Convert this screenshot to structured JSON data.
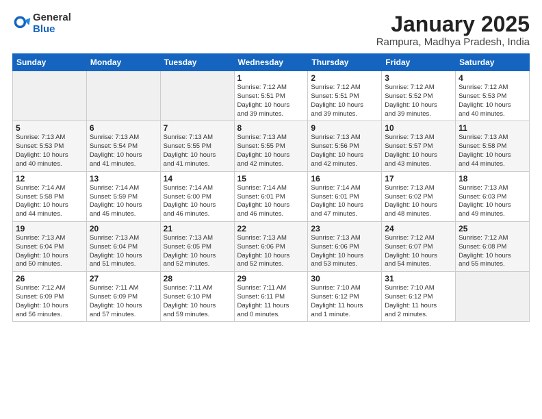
{
  "logo": {
    "general": "General",
    "blue": "Blue"
  },
  "header": {
    "title": "January 2025",
    "subtitle": "Rampura, Madhya Pradesh, India"
  },
  "weekdays": [
    "Sunday",
    "Monday",
    "Tuesday",
    "Wednesday",
    "Thursday",
    "Friday",
    "Saturday"
  ],
  "weeks": [
    [
      {
        "day": "",
        "info": ""
      },
      {
        "day": "",
        "info": ""
      },
      {
        "day": "",
        "info": ""
      },
      {
        "day": "1",
        "info": "Sunrise: 7:12 AM\nSunset: 5:51 PM\nDaylight: 10 hours\nand 39 minutes."
      },
      {
        "day": "2",
        "info": "Sunrise: 7:12 AM\nSunset: 5:51 PM\nDaylight: 10 hours\nand 39 minutes."
      },
      {
        "day": "3",
        "info": "Sunrise: 7:12 AM\nSunset: 5:52 PM\nDaylight: 10 hours\nand 39 minutes."
      },
      {
        "day": "4",
        "info": "Sunrise: 7:12 AM\nSunset: 5:53 PM\nDaylight: 10 hours\nand 40 minutes."
      }
    ],
    [
      {
        "day": "5",
        "info": "Sunrise: 7:13 AM\nSunset: 5:53 PM\nDaylight: 10 hours\nand 40 minutes."
      },
      {
        "day": "6",
        "info": "Sunrise: 7:13 AM\nSunset: 5:54 PM\nDaylight: 10 hours\nand 41 minutes."
      },
      {
        "day": "7",
        "info": "Sunrise: 7:13 AM\nSunset: 5:55 PM\nDaylight: 10 hours\nand 41 minutes."
      },
      {
        "day": "8",
        "info": "Sunrise: 7:13 AM\nSunset: 5:55 PM\nDaylight: 10 hours\nand 42 minutes."
      },
      {
        "day": "9",
        "info": "Sunrise: 7:13 AM\nSunset: 5:56 PM\nDaylight: 10 hours\nand 42 minutes."
      },
      {
        "day": "10",
        "info": "Sunrise: 7:13 AM\nSunset: 5:57 PM\nDaylight: 10 hours\nand 43 minutes."
      },
      {
        "day": "11",
        "info": "Sunrise: 7:13 AM\nSunset: 5:58 PM\nDaylight: 10 hours\nand 44 minutes."
      }
    ],
    [
      {
        "day": "12",
        "info": "Sunrise: 7:14 AM\nSunset: 5:58 PM\nDaylight: 10 hours\nand 44 minutes."
      },
      {
        "day": "13",
        "info": "Sunrise: 7:14 AM\nSunset: 5:59 PM\nDaylight: 10 hours\nand 45 minutes."
      },
      {
        "day": "14",
        "info": "Sunrise: 7:14 AM\nSunset: 6:00 PM\nDaylight: 10 hours\nand 46 minutes."
      },
      {
        "day": "15",
        "info": "Sunrise: 7:14 AM\nSunset: 6:01 PM\nDaylight: 10 hours\nand 46 minutes."
      },
      {
        "day": "16",
        "info": "Sunrise: 7:14 AM\nSunset: 6:01 PM\nDaylight: 10 hours\nand 47 minutes."
      },
      {
        "day": "17",
        "info": "Sunrise: 7:13 AM\nSunset: 6:02 PM\nDaylight: 10 hours\nand 48 minutes."
      },
      {
        "day": "18",
        "info": "Sunrise: 7:13 AM\nSunset: 6:03 PM\nDaylight: 10 hours\nand 49 minutes."
      }
    ],
    [
      {
        "day": "19",
        "info": "Sunrise: 7:13 AM\nSunset: 6:04 PM\nDaylight: 10 hours\nand 50 minutes."
      },
      {
        "day": "20",
        "info": "Sunrise: 7:13 AM\nSunset: 6:04 PM\nDaylight: 10 hours\nand 51 minutes."
      },
      {
        "day": "21",
        "info": "Sunrise: 7:13 AM\nSunset: 6:05 PM\nDaylight: 10 hours\nand 52 minutes."
      },
      {
        "day": "22",
        "info": "Sunrise: 7:13 AM\nSunset: 6:06 PM\nDaylight: 10 hours\nand 52 minutes."
      },
      {
        "day": "23",
        "info": "Sunrise: 7:13 AM\nSunset: 6:06 PM\nDaylight: 10 hours\nand 53 minutes."
      },
      {
        "day": "24",
        "info": "Sunrise: 7:12 AM\nSunset: 6:07 PM\nDaylight: 10 hours\nand 54 minutes."
      },
      {
        "day": "25",
        "info": "Sunrise: 7:12 AM\nSunset: 6:08 PM\nDaylight: 10 hours\nand 55 minutes."
      }
    ],
    [
      {
        "day": "26",
        "info": "Sunrise: 7:12 AM\nSunset: 6:09 PM\nDaylight: 10 hours\nand 56 minutes."
      },
      {
        "day": "27",
        "info": "Sunrise: 7:11 AM\nSunset: 6:09 PM\nDaylight: 10 hours\nand 57 minutes."
      },
      {
        "day": "28",
        "info": "Sunrise: 7:11 AM\nSunset: 6:10 PM\nDaylight: 10 hours\nand 59 minutes."
      },
      {
        "day": "29",
        "info": "Sunrise: 7:11 AM\nSunset: 6:11 PM\nDaylight: 11 hours\nand 0 minutes."
      },
      {
        "day": "30",
        "info": "Sunrise: 7:10 AM\nSunset: 6:12 PM\nDaylight: 11 hours\nand 1 minute."
      },
      {
        "day": "31",
        "info": "Sunrise: 7:10 AM\nSunset: 6:12 PM\nDaylight: 11 hours\nand 2 minutes."
      },
      {
        "day": "",
        "info": ""
      }
    ]
  ]
}
